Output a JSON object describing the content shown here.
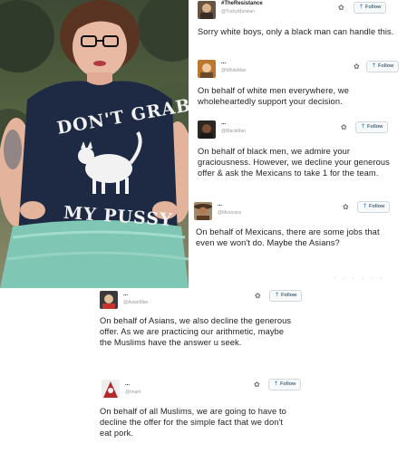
{
  "tweets": [
    {
      "username": "#TheResistance",
      "handle": "@TuckyMaxwan",
      "follow_label": "Follow",
      "text": "Sorry white boys, only a black man can handle this."
    },
    {
      "username": "...",
      "handle": "@WhiteMan",
      "follow_label": "Follow",
      "text": "On behalf of white men everywhere, we wholeheartedly support your decision."
    },
    {
      "username": "...",
      "handle": "@BlackMan",
      "follow_label": "Follow",
      "text": "On behalf of black men, we admire your graciousness. However, we decline your generous offer & ask the Mexicans to take 1 for the team."
    },
    {
      "username": "...",
      "handle": "@Mexicans",
      "follow_label": "Follow",
      "text": "On behalf of Mexicans, there are some jobs that even we won't do. Maybe the Asians?"
    },
    {
      "username": "...",
      "handle": "@AsianMan",
      "follow_label": "Follow",
      "text": "On behalf of Asians, we also decline the generous offer. As we are practicing our arithmetic, maybe the Muslims have the answer u seek."
    },
    {
      "username": "...",
      "handle": "@Imam",
      "follow_label": "Follow",
      "text": "On behalf of all Muslims, we are going to have to decline the offer for the simple fact that we don't eat pork."
    }
  ],
  "photo": {
    "shirt_text_top": "DON'T GRAB",
    "shirt_text_bottom": "MY PUSSY"
  },
  "icons": {
    "gear": "gear-icon",
    "follow_bird": "twitter-bird-icon"
  },
  "colors": {
    "follow_text": "#4a6a80",
    "bird": "#4a90c8",
    "shirt": "#1e2a44",
    "skirt": "#7fc6b4"
  }
}
